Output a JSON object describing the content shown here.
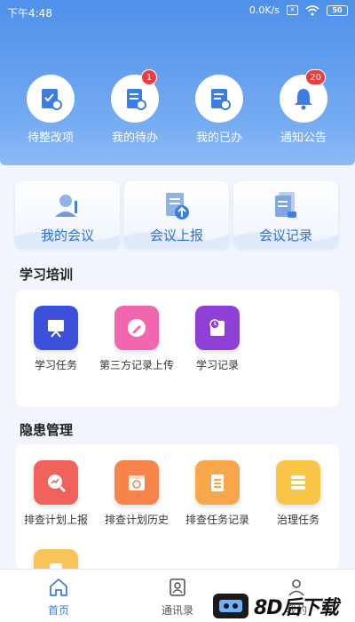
{
  "status_bar": {
    "time": "下午4:48",
    "speed": "0.0K/s",
    "battery": "50"
  },
  "quick_actions": [
    {
      "label": "待整改项",
      "icon": "rectification-icon"
    },
    {
      "label": "我的待办",
      "icon": "todo-list-icon",
      "badge": "1"
    },
    {
      "label": "我的已办",
      "icon": "done-doc-icon"
    },
    {
      "label": "通知公告",
      "icon": "bell-icon",
      "badge": "20"
    }
  ],
  "meeting_cards": [
    {
      "label": "我的会议",
      "icon": "meeting-user-icon"
    },
    {
      "label": "会议上报",
      "icon": "upload-doc-icon"
    },
    {
      "label": "会议记录",
      "icon": "record-doc-icon"
    }
  ],
  "study": {
    "title": "学习培训",
    "items": [
      {
        "label": "学习任务",
        "icon": "presentation-icon",
        "color": "#3b4fd8"
      },
      {
        "label": "第三方记录上传",
        "icon": "pencil-icon",
        "color": "#f067b0"
      },
      {
        "label": "学习记录",
        "icon": "book-clock-icon",
        "color": "#8e3fd6"
      }
    ]
  },
  "hazard": {
    "title": "隐患管理",
    "items": [
      {
        "label": "排查计划上报",
        "icon": "magnify-chart-icon",
        "color": "#f0625c"
      },
      {
        "label": "排查计划历史",
        "icon": "calendar-history-icon",
        "color": "#f7844a"
      },
      {
        "label": "排查任务记录",
        "icon": "notepad-icon",
        "color": "#f8a84b"
      },
      {
        "label": "治理任务",
        "icon": "list-icon",
        "color": "#f9c64a"
      },
      {
        "label": "",
        "icon": "clipboard-icon",
        "color": "#f9c45a"
      }
    ]
  },
  "bottom_nav": [
    {
      "label": "首页",
      "icon": "home-icon",
      "active": true
    },
    {
      "label": "通讯录",
      "icon": "contacts-icon",
      "active": false
    },
    {
      "label": "我的",
      "icon": "person-icon",
      "active": false
    }
  ],
  "watermark": {
    "text": "8D后下载"
  },
  "colors": {
    "header_top": "#4f90ea",
    "accent": "#3d7ee0",
    "badge": "#ef3b3b"
  }
}
